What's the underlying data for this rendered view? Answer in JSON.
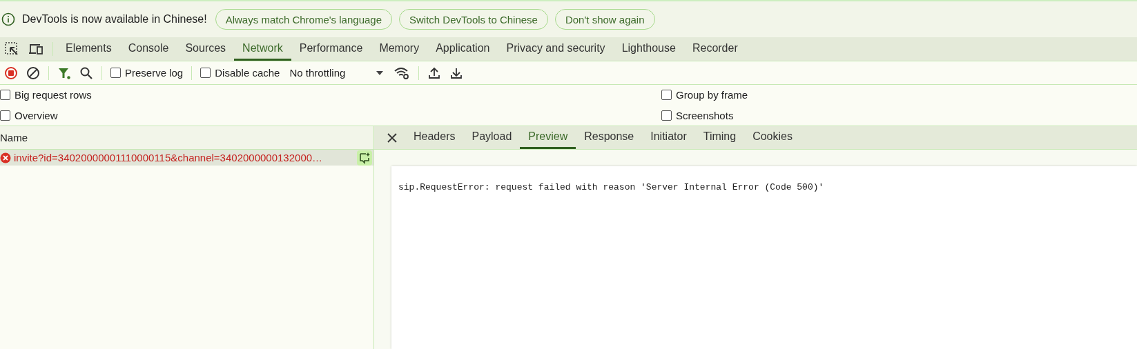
{
  "infobar": {
    "message": "DevTools is now available in Chinese!",
    "buttons": [
      "Always match Chrome's language",
      "Switch DevTools to Chinese",
      "Don't show again"
    ]
  },
  "tabs": [
    {
      "label": "Elements",
      "selected": false
    },
    {
      "label": "Console",
      "selected": false
    },
    {
      "label": "Sources",
      "selected": false
    },
    {
      "label": "Network",
      "selected": true
    },
    {
      "label": "Performance",
      "selected": false
    },
    {
      "label": "Memory",
      "selected": false
    },
    {
      "label": "Application",
      "selected": false
    },
    {
      "label": "Privacy and security",
      "selected": false
    },
    {
      "label": "Lighthouse",
      "selected": false
    },
    {
      "label": "Recorder",
      "selected": false
    }
  ],
  "toolbar": {
    "recording": true,
    "preserve_log": {
      "label": "Preserve log",
      "checked": false
    },
    "disable_cache": {
      "label": "Disable cache",
      "checked": false
    },
    "throttling": "No throttling"
  },
  "settings_left": [
    {
      "label": "Big request rows",
      "checked": false
    },
    {
      "label": "Overview",
      "checked": false
    }
  ],
  "settings_right": [
    {
      "label": "Group by frame",
      "checked": false
    },
    {
      "label": "Screenshots",
      "checked": false
    }
  ],
  "requests": {
    "column": "Name",
    "rows": [
      {
        "name": "invite?id=34020000001110000115&channel=3402000000132000…",
        "failed": true,
        "selected": true
      }
    ]
  },
  "detail_tabs": [
    {
      "label": "Headers",
      "selected": false
    },
    {
      "label": "Payload",
      "selected": false
    },
    {
      "label": "Preview",
      "selected": true
    },
    {
      "label": "Response",
      "selected": false
    },
    {
      "label": "Initiator",
      "selected": false
    },
    {
      "label": "Timing",
      "selected": false
    },
    {
      "label": "Cookies",
      "selected": false
    }
  ],
  "preview": "sip.RequestError: request failed with reason 'Server Internal Error (Code 500)'"
}
